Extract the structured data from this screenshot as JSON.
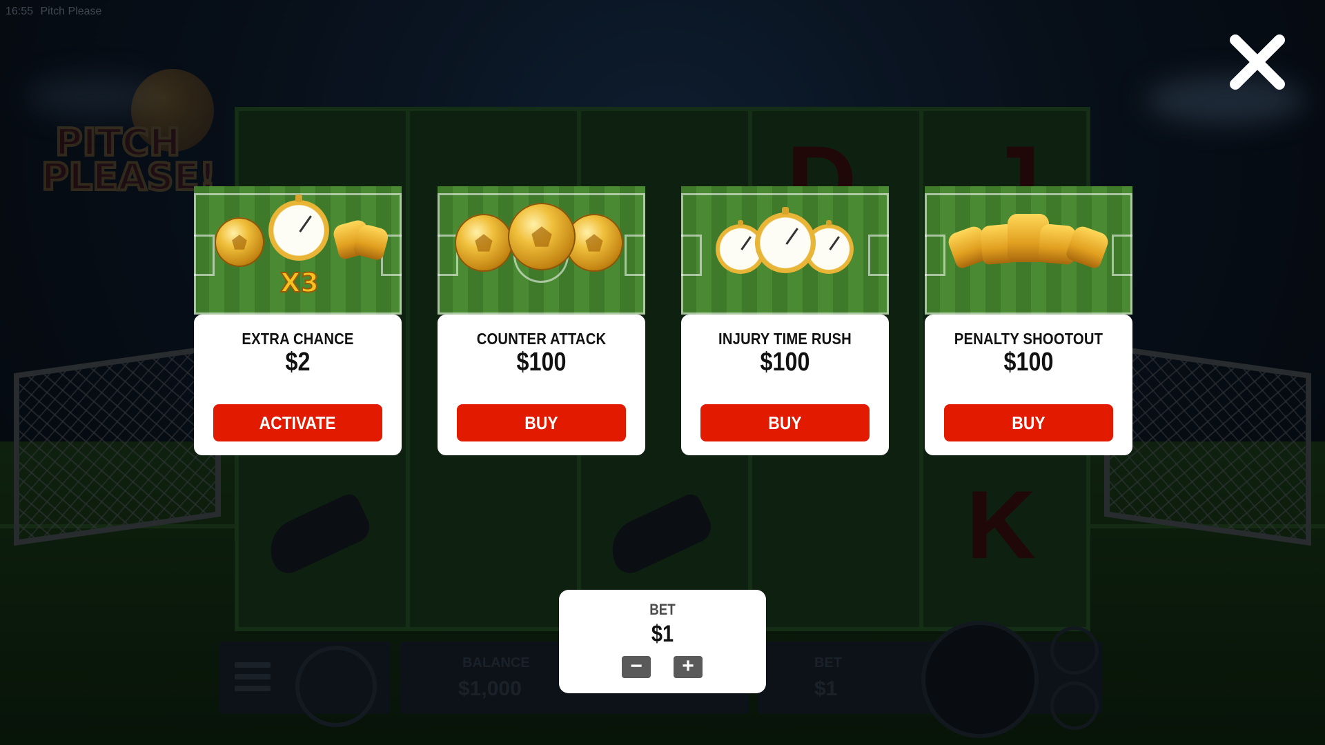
{
  "status_bar": {
    "time": "16:55",
    "title": "Pitch Please"
  },
  "game": {
    "logo_line1": "PITCH",
    "logo_line2": "PLEASE!",
    "balance_label": "BALANCE",
    "balance_value": "$1,000",
    "bet_label": "BET",
    "bet_value": "$1",
    "reel_symbols": [
      "D",
      "J",
      "K"
    ]
  },
  "close_icon": "close-icon",
  "cards": [
    {
      "title": "EXTRA CHANCE",
      "price": "$2",
      "button": "ACTIVATE",
      "multiplier": "X3",
      "image": "coin-watch-glove"
    },
    {
      "title": "COUNTER ATTACK",
      "price": "$100",
      "button": "BUY",
      "image": "three-coins"
    },
    {
      "title": "INJURY TIME RUSH",
      "price": "$100",
      "button": "BUY",
      "image": "three-stopwatches"
    },
    {
      "title": "PENALTY SHOOTOUT",
      "price": "$100",
      "button": "BUY",
      "image": "three-gloves"
    }
  ],
  "bet_panel": {
    "label": "BET",
    "value": "$1",
    "decrease": "−",
    "increase": "+"
  },
  "colors": {
    "button_red": "#e21a00",
    "card_white": "#ffffff",
    "pitch_green": "#4a8a33"
  }
}
